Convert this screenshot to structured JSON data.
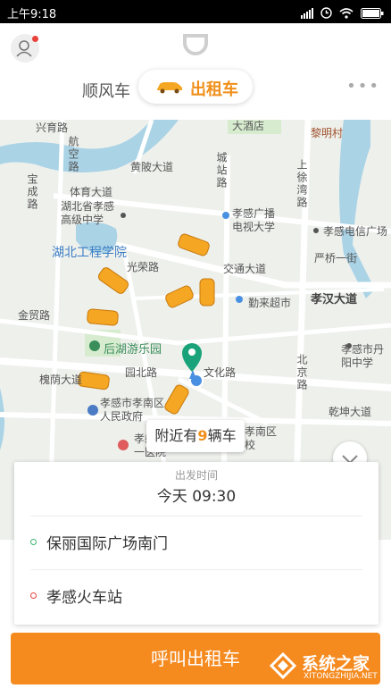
{
  "status_bar": {
    "time": "上午9:18"
  },
  "header": {
    "tabs": [
      {
        "label": "顺风车"
      },
      {
        "label": "出租车"
      }
    ]
  },
  "map": {
    "callout": {
      "prefix": "附近有",
      "count": "9",
      "suffix": "辆车"
    },
    "labels": {
      "hubei_gongcheng": "湖北工程学院",
      "huangling": "黄陂大道",
      "tiyu": "体育大道",
      "hubei_school": "湖北省孝感高级中学",
      "hangkong": "航空路",
      "baocheng": "宝成路",
      "chengzhan": "城站路",
      "shangxu": "上徐湾路",
      "dajiudian": "大酒店",
      "liming": "黎明村",
      "tvuni": "孝感广播电视大学",
      "telecom": "孝感电信广场",
      "yanqiao": "严桥一街",
      "jiaotong": "交通大道",
      "guangrong": "光荣路",
      "qinlai": "勤来超市",
      "xiaohan": "孝汉大道",
      "jinmao": "金贸路",
      "houhu": "后湖游乐园",
      "yuanbei": "园北路",
      "wenhua": "文化路",
      "huaiyin": "槐荫大道",
      "gov": "孝感市孝南区人民政府",
      "hospital": "孝感市第一医院",
      "admin_school": "孝感市孝南区行政学校",
      "beijing": "北京路",
      "danyang": "孝感市丹阳中学",
      "qiandong": "乾坤大道",
      "top_left": "兴育路"
    }
  },
  "trip_card": {
    "time_label": "出发时间",
    "time_value": "今天 09:30",
    "origin": "保丽国际广场南门",
    "destination": "孝感火车站"
  },
  "call_button": {
    "label": "呼叫出租车"
  },
  "watermark": {
    "text": "系统之家",
    "url": "XITONGZHIJIA.NET"
  },
  "colors": {
    "accent": "#f58a1f",
    "origin_dot": "#3cb371",
    "dest_dot": "#e8423a",
    "pin": "#1aa37a"
  }
}
